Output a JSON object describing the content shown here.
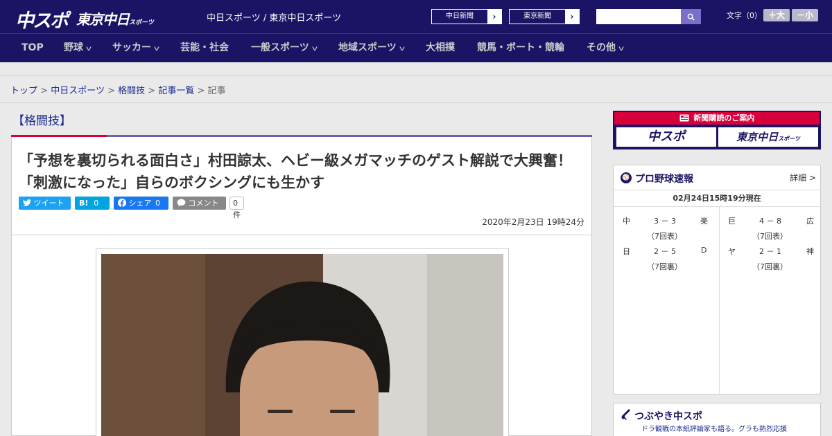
{
  "header": {
    "logo_chuspo": "中スポ",
    "logo_tokyo": "東京中日",
    "logo_tokyo_sub": "スポーツ",
    "tagline": "中日スポーツ / 東京中日スポーツ",
    "ext_links": [
      "中日新聞",
      "東京新聞"
    ],
    "search_placeholder": "",
    "fontsize_label": "文字（0）",
    "fontsize_up": "＋大",
    "fontsize_down": "－小",
    "colors": {
      "primary": "#1b1464",
      "accent_red": "#d7003a",
      "accent_purple": "#6a63a8"
    }
  },
  "nav": {
    "items": [
      {
        "label": "TOP",
        "has_menu": false
      },
      {
        "label": "野球",
        "has_menu": true
      },
      {
        "label": "サッカー",
        "has_menu": true
      },
      {
        "label": "芸能・社会",
        "has_menu": false
      },
      {
        "label": "一般スポーツ",
        "has_menu": true
      },
      {
        "label": "地域スポーツ",
        "has_menu": true
      },
      {
        "label": "大相撲",
        "has_menu": false
      },
      {
        "label": "競馬・ボート・競輪",
        "has_menu": false
      },
      {
        "label": "その他",
        "has_menu": true
      }
    ]
  },
  "breadcrumb": {
    "items": [
      "トップ",
      "中日スポーツ",
      "格闘技",
      "記事一覧"
    ],
    "current": "記事",
    "separator": ">"
  },
  "article": {
    "category": "【格闘技】",
    "title": "「予想を裏切られる面白さ」村田諒太、ヘビー級メガマッチのゲスト解説で大興奮！「刺激になった」自らのボクシングにも生かす",
    "share": {
      "tweet": "ツイート",
      "hatena": "B!",
      "hatena_count": "0",
      "facebook": "シェア",
      "facebook_count": "0",
      "comment": "コメント",
      "comment_count": "0件"
    },
    "date": "2020年2月23日 19時24分"
  },
  "sidebar": {
    "ad": {
      "title": "新聞購読のご案内",
      "logo_left": "中スポ",
      "logo_right": "東京中日",
      "logo_right_sub": "スポーツ"
    },
    "baseball": {
      "title": "プロ野球速報",
      "detail": "詳細 >",
      "updated": "02月24日15時19分現在",
      "games": [
        {
          "home": "中",
          "score": "3 － 3",
          "away": "楽",
          "status": "（7回表）"
        },
        {
          "home": "巨",
          "score": "4 － 8",
          "away": "広",
          "status": "（7回表）"
        },
        {
          "home": "日",
          "score": "2 － 5",
          "away": "D",
          "status": "（7回裏）"
        },
        {
          "home": "ヤ",
          "score": "2 － 1",
          "away": "神",
          "status": "（7回裏）"
        }
      ]
    },
    "tweet": {
      "title": "つぶやき中スポ",
      "subtitle": "ドラ観戦の本紙評論家も語る。グラも熱烈応援"
    }
  }
}
